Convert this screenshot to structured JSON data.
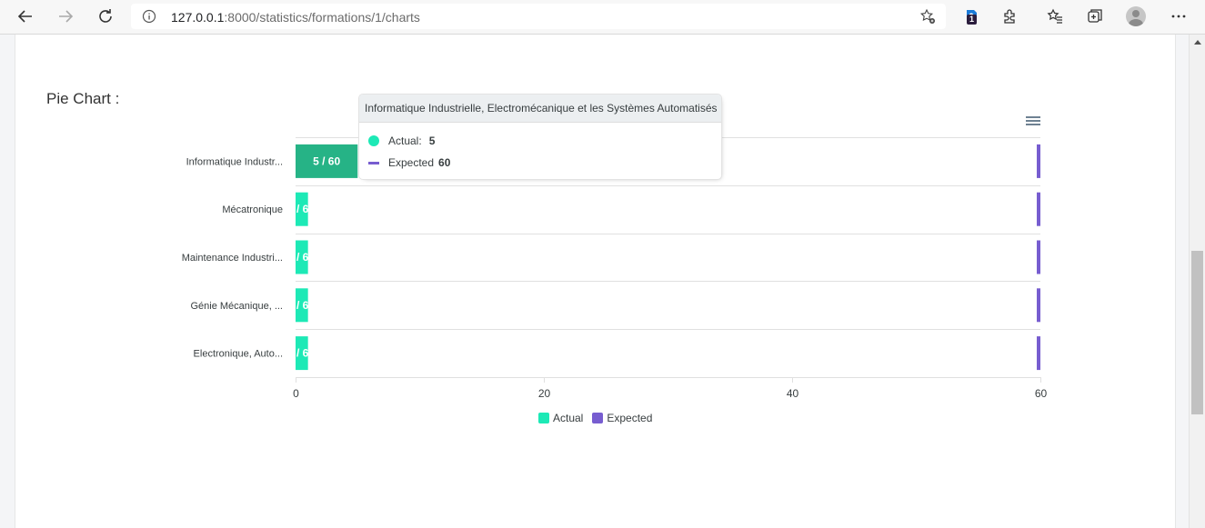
{
  "browser": {
    "url_host": "127.0.0.1",
    "url_path": ":8000/statistics/formations/1/charts",
    "extension_badge": "1"
  },
  "page": {
    "section_title": "Pie Chart :"
  },
  "colors": {
    "actual": "#1de9b6",
    "actual_hover": "#26b386",
    "expected": "#775dd0"
  },
  "chart_data": {
    "type": "bar",
    "orientation": "horizontal",
    "categories": [
      "Informatique Industr...",
      "Mécatronique",
      "Maintenance Industri...",
      "Génie Mécanique, ...",
      "Electronique, Auto..."
    ],
    "series": [
      {
        "name": "Actual",
        "values": [
          5,
          1,
          1,
          1,
          1
        ]
      },
      {
        "name": "Expected",
        "values": [
          60,
          60,
          60,
          60,
          60
        ]
      }
    ],
    "bar_labels": [
      "5 / 60",
      "/ 6",
      "/ 6",
      "/ 6",
      "/ 6"
    ],
    "xlim": [
      0,
      60
    ],
    "xticks": [
      "0",
      "20",
      "40",
      "60"
    ],
    "legend": [
      "Actual",
      "Expected"
    ],
    "legend_position": "bottom"
  },
  "tooltip": {
    "title": "Informatique Industrielle, Electromécanique et les Systèmes Automatisés",
    "actual_label": "Actual:",
    "actual_value": "5",
    "expected_label": "Expected",
    "expected_value": "60"
  }
}
